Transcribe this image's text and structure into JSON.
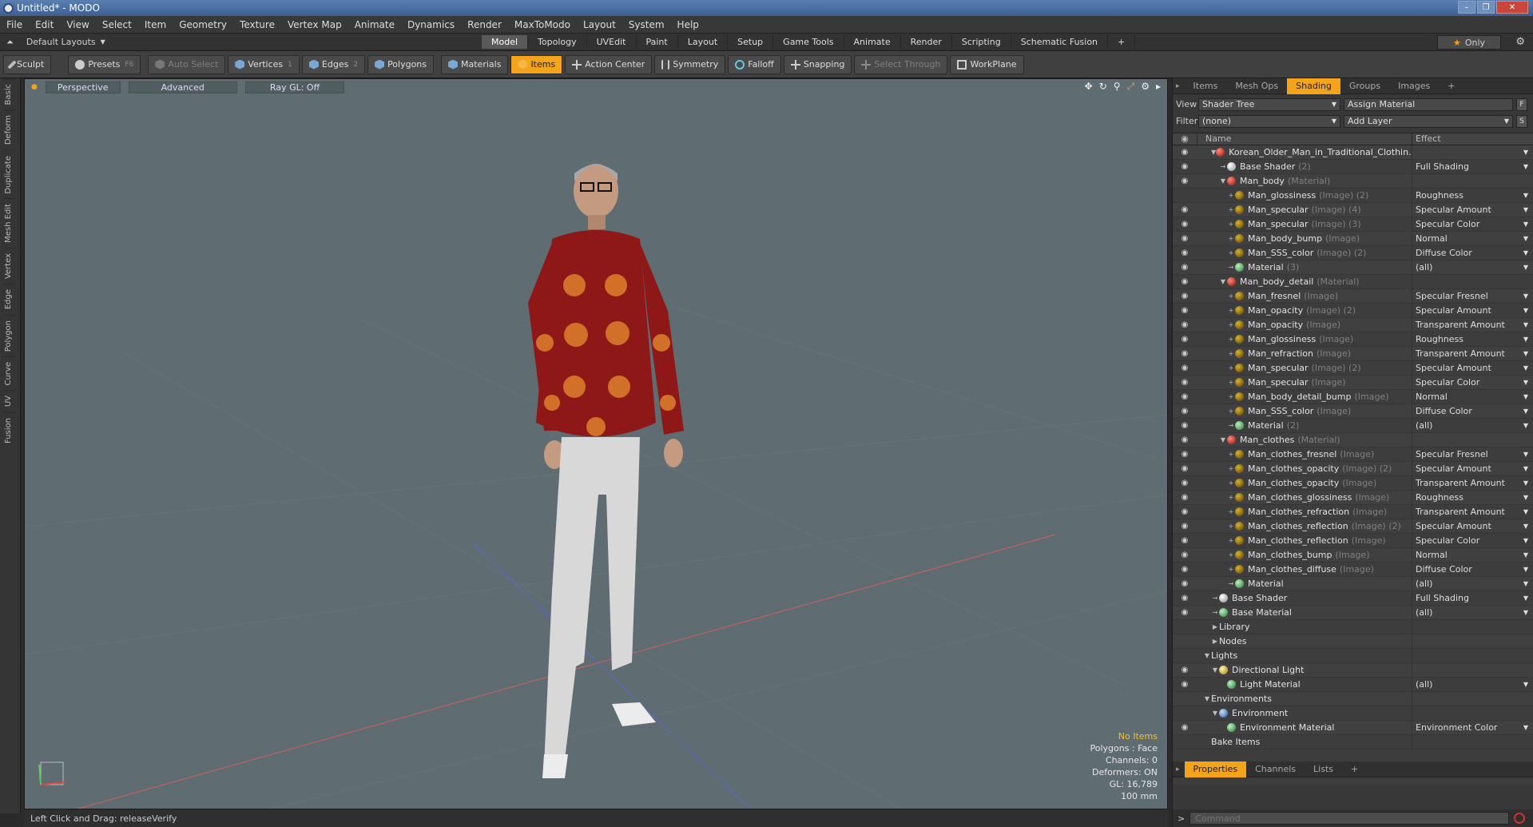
{
  "window": {
    "title": "Untitled* - MODO",
    "controls": [
      "–",
      "❐",
      "✕"
    ]
  },
  "menu": [
    "File",
    "Edit",
    "View",
    "Select",
    "Item",
    "Geometry",
    "Texture",
    "Vertex Map",
    "Animate",
    "Dynamics",
    "Render",
    "MaxToModo",
    "Layout",
    "System",
    "Help"
  ],
  "layout": {
    "selector": "Default Layouts",
    "tabs": [
      "Model",
      "Topology",
      "UVEdit",
      "Paint",
      "Layout",
      "Setup",
      "Game Tools",
      "Animate",
      "Render",
      "Scripting",
      "Schematic Fusion"
    ],
    "active_tab": "Model",
    "add": "+",
    "only": "Only"
  },
  "toolbar": {
    "sculpt": "Sculpt",
    "presets": "Presets",
    "presets_key": "F6",
    "auto_select": "Auto Select",
    "vertices": "Vertices",
    "vertices_key": "1",
    "edges": "Edges",
    "edges_key": "2",
    "polygons": "Polygons",
    "materials": "Materials",
    "items": "Items",
    "action_center": "Action Center",
    "symmetry": "Symmetry",
    "falloff": "Falloff",
    "snapping": "Snapping",
    "select_through": "Select Through",
    "workplane": "WorkPlane"
  },
  "left_tabs": [
    "Basic",
    "Deform",
    "Duplicate",
    "Mesh Edit",
    "Vertex",
    "Edge",
    "Polygon",
    "Curve",
    "UV",
    "Fusion"
  ],
  "viewport": {
    "view": "Perspective",
    "mode": "Advanced",
    "raygl": "Ray GL: Off",
    "info": {
      "items": "No Items",
      "polygons": "Polygons : Face",
      "channels": "Channels: 0",
      "deformers": "Deformers: ON",
      "gl": "GL: 16,789",
      "scale": "100 mm"
    }
  },
  "status": {
    "text": "Left Click and Drag:  releaseVerify"
  },
  "right_panel": {
    "tabs": [
      "Items",
      "Mesh Ops",
      "Shading",
      "Groups",
      "Images"
    ],
    "active_tab": "Shading",
    "add": "+",
    "view_label": "View",
    "view_value": "Shader Tree",
    "assign_material": "Assign Material",
    "f_btn": "F",
    "filter_label": "Filter",
    "filter_value": "(none)",
    "add_layer": "Add Layer",
    "s_btn": "S",
    "col_name": "Name",
    "col_effect": "Effect",
    "tree": [
      {
        "level": 1,
        "arrow": "▼",
        "icon": "mat",
        "name": "Korean_Older_Man_in_Traditional_Clothin...",
        "sub": "",
        "effect": "",
        "eye": true,
        "drop": true
      },
      {
        "level": 2,
        "arrow": "→",
        "icon": "shd",
        "name": "Base Shader",
        "sub": "(2)",
        "effect": "Full Shading",
        "eye": true,
        "drop": true
      },
      {
        "level": 2,
        "arrow": "▼",
        "icon": "mat",
        "name": "Man_body",
        "sub": "(Material)",
        "effect": "",
        "eye": true,
        "drop": false
      },
      {
        "level": 3,
        "arrow": "+",
        "icon": "tex",
        "name": "Man_glossiness",
        "sub": "(Image) (2)",
        "effect": "Roughness",
        "eye": false,
        "drop": true
      },
      {
        "level": 3,
        "arrow": "+",
        "icon": "tex",
        "name": "Man_specular",
        "sub": "(Image) (4)",
        "effect": "Specular Amount",
        "eye": true,
        "drop": true
      },
      {
        "level": 3,
        "arrow": "+",
        "icon": "tex",
        "name": "Man_specular",
        "sub": "(Image) (3)",
        "effect": "Specular Color",
        "eye": true,
        "drop": true
      },
      {
        "level": 3,
        "arrow": "+",
        "icon": "tex",
        "name": "Man_body_bump",
        "sub": "(Image)",
        "effect": "Normal",
        "eye": true,
        "drop": true
      },
      {
        "level": 3,
        "arrow": "+",
        "icon": "tex",
        "name": "Man_SSS_color",
        "sub": "(Image) (2)",
        "effect": "Diffuse Color",
        "eye": true,
        "drop": true
      },
      {
        "level": 3,
        "arrow": "→",
        "icon": "mtl",
        "name": "Material",
        "sub": "(3)",
        "effect": "(all)",
        "eye": true,
        "drop": true
      },
      {
        "level": 2,
        "arrow": "▼",
        "icon": "mat",
        "name": "Man_body_detail",
        "sub": "(Material)",
        "effect": "",
        "eye": true,
        "drop": false
      },
      {
        "level": 3,
        "arrow": "+",
        "icon": "tex",
        "name": "Man_fresnel",
        "sub": "(Image)",
        "effect": "Specular Fresnel",
        "eye": true,
        "drop": true
      },
      {
        "level": 3,
        "arrow": "+",
        "icon": "tex",
        "name": "Man_opacity",
        "sub": "(Image) (2)",
        "effect": "Specular Amount",
        "eye": true,
        "drop": true
      },
      {
        "level": 3,
        "arrow": "+",
        "icon": "tex",
        "name": "Man_opacity",
        "sub": "(Image)",
        "effect": "Transparent Amount",
        "eye": true,
        "drop": true
      },
      {
        "level": 3,
        "arrow": "+",
        "icon": "tex",
        "name": "Man_glossiness",
        "sub": "(Image)",
        "effect": "Roughness",
        "eye": true,
        "drop": true
      },
      {
        "level": 3,
        "arrow": "+",
        "icon": "tex",
        "name": "Man_refraction",
        "sub": "(Image)",
        "effect": "Transparent Amount",
        "eye": true,
        "drop": true
      },
      {
        "level": 3,
        "arrow": "+",
        "icon": "tex",
        "name": "Man_specular",
        "sub": "(Image) (2)",
        "effect": "Specular Amount",
        "eye": true,
        "drop": true
      },
      {
        "level": 3,
        "arrow": "+",
        "icon": "tex",
        "name": "Man_specular",
        "sub": "(Image)",
        "effect": "Specular Color",
        "eye": true,
        "drop": true
      },
      {
        "level": 3,
        "arrow": "+",
        "icon": "tex",
        "name": "Man_body_detail_bump",
        "sub": "(Image)",
        "effect": "Normal",
        "eye": true,
        "drop": true
      },
      {
        "level": 3,
        "arrow": "+",
        "icon": "tex",
        "name": "Man_SSS_color",
        "sub": "(Image)",
        "effect": "Diffuse Color",
        "eye": true,
        "drop": true
      },
      {
        "level": 3,
        "arrow": "→",
        "icon": "mtl",
        "name": "Material",
        "sub": "(2)",
        "effect": "(all)",
        "eye": true,
        "drop": true
      },
      {
        "level": 2,
        "arrow": "▼",
        "icon": "mat",
        "name": "Man_clothes",
        "sub": "(Material)",
        "effect": "",
        "eye": true,
        "drop": false
      },
      {
        "level": 3,
        "arrow": "+",
        "icon": "tex",
        "name": "Man_clothes_fresnel",
        "sub": "(Image)",
        "effect": "Specular Fresnel",
        "eye": true,
        "drop": true
      },
      {
        "level": 3,
        "arrow": "+",
        "icon": "tex",
        "name": "Man_clothes_opacity",
        "sub": "(Image) (2)",
        "effect": "Specular Amount",
        "eye": true,
        "drop": true
      },
      {
        "level": 3,
        "arrow": "+",
        "icon": "tex",
        "name": "Man_clothes_opacity",
        "sub": "(Image)",
        "effect": "Transparent Amount",
        "eye": true,
        "drop": true
      },
      {
        "level": 3,
        "arrow": "+",
        "icon": "tex",
        "name": "Man_clothes_glossiness",
        "sub": "(Image)",
        "effect": "Roughness",
        "eye": true,
        "drop": true
      },
      {
        "level": 3,
        "arrow": "+",
        "icon": "tex",
        "name": "Man_clothes_refraction",
        "sub": "(Image)",
        "effect": "Transparent Amount",
        "eye": true,
        "drop": true
      },
      {
        "level": 3,
        "arrow": "+",
        "icon": "tex",
        "name": "Man_clothes_reflection",
        "sub": "(Image) (2)",
        "effect": "Specular Amount",
        "eye": true,
        "drop": true
      },
      {
        "level": 3,
        "arrow": "+",
        "icon": "tex",
        "name": "Man_clothes_reflection",
        "sub": "(Image)",
        "effect": "Specular Color",
        "eye": true,
        "drop": true
      },
      {
        "level": 3,
        "arrow": "+",
        "icon": "tex",
        "name": "Man_clothes_bump",
        "sub": "(Image)",
        "effect": "Normal",
        "eye": true,
        "drop": true
      },
      {
        "level": 3,
        "arrow": "+",
        "icon": "tex",
        "name": "Man_clothes_diffuse",
        "sub": "(Image)",
        "effect": "Diffuse Color",
        "eye": true,
        "drop": true
      },
      {
        "level": 3,
        "arrow": "→",
        "icon": "mtl",
        "name": "Material",
        "sub": "",
        "effect": "(all)",
        "eye": true,
        "drop": true
      },
      {
        "level": 1,
        "arrow": "→",
        "icon": "shd",
        "name": "Base Shader",
        "sub": "",
        "effect": "Full Shading",
        "eye": true,
        "drop": true
      },
      {
        "level": 1,
        "arrow": "→",
        "icon": "mtl",
        "name": "Base Material",
        "sub": "",
        "effect": "(all)",
        "eye": true,
        "drop": true
      },
      {
        "level": 1,
        "arrow": "▶",
        "icon": "",
        "name": "Library",
        "sub": "",
        "effect": "",
        "eye": false,
        "drop": false
      },
      {
        "level": 1,
        "arrow": "▶",
        "icon": "",
        "name": "Nodes",
        "sub": "",
        "effect": "",
        "eye": false,
        "drop": false
      },
      {
        "level": 0,
        "arrow": "▼",
        "icon": "",
        "name": "Lights",
        "sub": "",
        "effect": "",
        "eye": false,
        "drop": false
      },
      {
        "level": 1,
        "arrow": "▼",
        "icon": "lgt",
        "name": "Directional Light",
        "sub": "",
        "effect": "",
        "eye": true,
        "drop": false
      },
      {
        "level": 2,
        "arrow": "",
        "icon": "mtl",
        "name": "Light Material",
        "sub": "",
        "effect": "(all)",
        "eye": true,
        "drop": true
      },
      {
        "level": 0,
        "arrow": "▼",
        "icon": "",
        "name": "Environments",
        "sub": "",
        "effect": "",
        "eye": false,
        "drop": false
      },
      {
        "level": 1,
        "arrow": "▼",
        "icon": "env",
        "name": "Environment",
        "sub": "",
        "effect": "",
        "eye": false,
        "drop": false
      },
      {
        "level": 2,
        "arrow": "",
        "icon": "mtl",
        "name": "Environment Material",
        "sub": "",
        "effect": "Environment Color",
        "eye": true,
        "drop": true
      },
      {
        "level": 0,
        "arrow": "",
        "icon": "",
        "name": "Bake Items",
        "sub": "",
        "effect": "",
        "eye": false,
        "drop": false
      }
    ],
    "bottom_tabs": [
      "Properties",
      "Channels",
      "Lists"
    ],
    "bottom_active": "Properties",
    "command_placeholder": "Command",
    "command_prompt": ">"
  }
}
